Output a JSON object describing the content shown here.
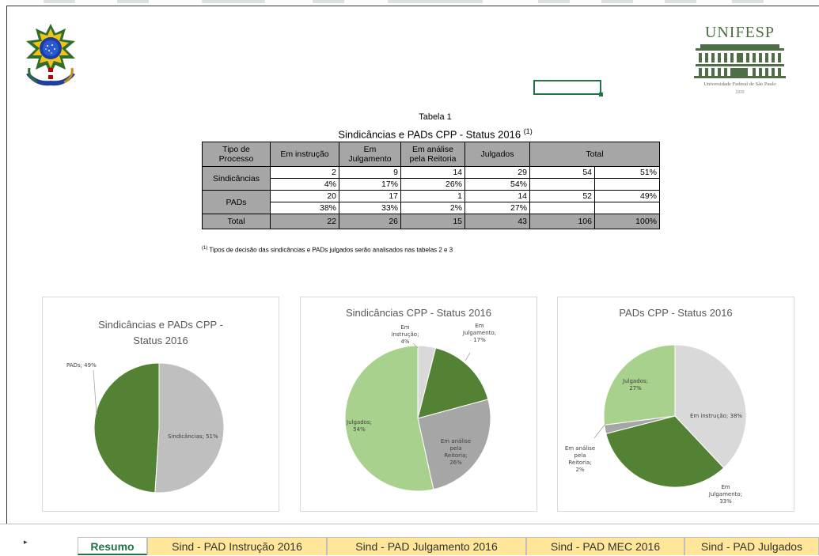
{
  "header": {
    "logo_left": "brasil-coat-of-arms",
    "logo_right": {
      "title": "UNIFESP",
      "subtitle": "Universidade Federal de São Paulo",
      "year": "1933"
    }
  },
  "table": {
    "caption": "Tabela 1",
    "title": "Sindicâncias e PADs CPP - Status 2016",
    "title_note": "(1)",
    "headers": [
      "Tipo de Processo",
      "Em instrução",
      "Em Julgamento",
      "Em análise pela Reitoria",
      "Julgados",
      "Total"
    ],
    "rows": [
      {
        "label": "Sindicâncias",
        "counts": [
          "2",
          "9",
          "14",
          "29"
        ],
        "total": "54",
        "total_pct": "51%",
        "pcts": [
          "4%",
          "17%",
          "26%",
          "54%"
        ]
      },
      {
        "label": "PADs",
        "counts": [
          "20",
          "17",
          "1",
          "14"
        ],
        "total": "52",
        "total_pct": "49%",
        "pcts": [
          "38%",
          "33%",
          "2%",
          "27%"
        ]
      }
    ],
    "total_row": {
      "label": "Total",
      "values": [
        "22",
        "26",
        "15",
        "43"
      ],
      "total": "106",
      "total_pct": "100%"
    },
    "footnote_mark": "(1)",
    "footnote": "Tipos de decisão das sindicâncias e PADs julgados serão analisados nas tabelas 2 e 3"
  },
  "charts": [
    {
      "title": "Sindicâncias e PADs CPP - Status 2016",
      "slices": [
        {
          "label": "Sindicâncias; 51%",
          "value": 51,
          "color": "#bfbfbf"
        },
        {
          "label": "PADs; 49%",
          "value": 49,
          "color": "#548235"
        }
      ]
    },
    {
      "title": "Sindicâncias CPP - Status 2016",
      "slices": [
        {
          "label": "Em instrução; 4%",
          "value": 4,
          "color": "#d9d9d9"
        },
        {
          "label": "Em Julgamento; 17%",
          "value": 17,
          "color": "#548235"
        },
        {
          "label": "Em análise pela Reitoria; 26%",
          "value": 26,
          "color": "#a6a6a6"
        },
        {
          "label": "Julgados; 54%",
          "value": 54,
          "color": "#a9d18e"
        }
      ]
    },
    {
      "title": "PADs CPP - Status 2016",
      "slices": [
        {
          "label": "Em instrução; 38%",
          "value": 38,
          "color": "#d9d9d9"
        },
        {
          "label": "Em Julgamento; 33%",
          "value": 33,
          "color": "#548235"
        },
        {
          "label": "Em análise pela Reitoria; 2%",
          "value": 2,
          "color": "#a6a6a6"
        },
        {
          "label": "Julgados; 27%",
          "value": 27,
          "color": "#a9d18e"
        }
      ]
    }
  ],
  "tabs": {
    "nav_arrow": "▸",
    "items": [
      "Resumo",
      "Sind - PAD Instrução 2016",
      "Sind - PAD Julgamento 2016",
      "Sind - PAD MEC 2016",
      "Sind - PAD Julgados"
    ],
    "active": "Resumo"
  },
  "colors": {
    "excel_green": "#217346",
    "tab_yellow": "#ffe699",
    "header_gray": "#a6a6a6"
  }
}
